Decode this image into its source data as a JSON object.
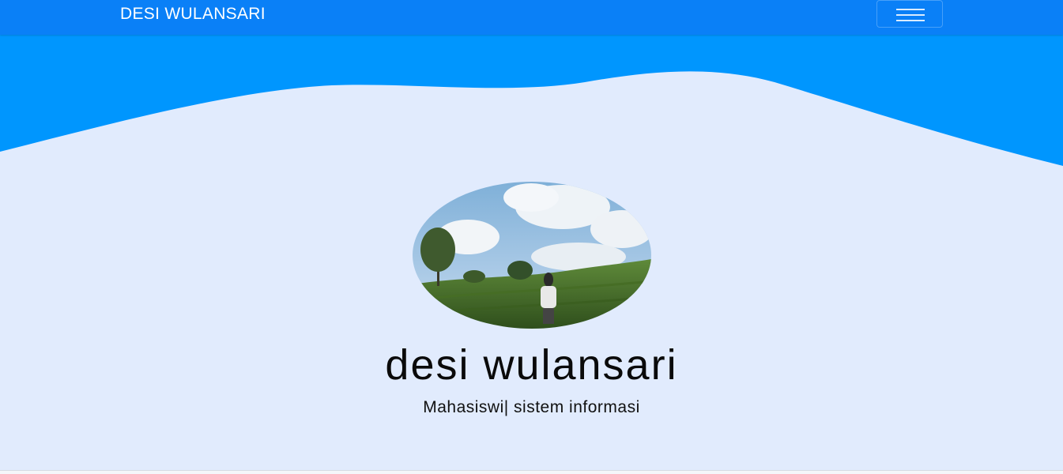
{
  "navbar": {
    "brand": "DESI WULANSARI",
    "toggler_icon": "hamburger-menu-icon",
    "color": "#0a80f7"
  },
  "hero": {
    "wave_color": "#0096fe",
    "background_color": "#e1ebfd",
    "avatar_description_icon": "profile-photo",
    "name": "desi wulansari",
    "subtitle": "Mahasiswi| sistem informasi"
  }
}
